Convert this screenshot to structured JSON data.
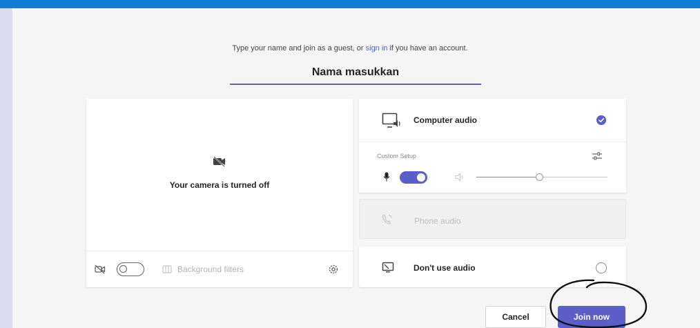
{
  "prompt": {
    "before": "Type your name and join as a guest, or ",
    "link": "sign in",
    "after": " if you have an account."
  },
  "name_input": {
    "value": "Nama masukkan"
  },
  "video": {
    "camera_status": "Your camera is turned off",
    "camera_toggle_on": false,
    "background_filters_label": "Background filters",
    "icons": [
      "camera-off-icon",
      "video-camera-icon",
      "background-filters-icon",
      "settings-gear-icon"
    ]
  },
  "audio": {
    "computer_audio_label": "Computer audio",
    "computer_audio_selected": true,
    "custom_setup_label": "Custom Setup",
    "mic_on": true,
    "volume_level": 0.48,
    "phone_audio_label": "Phone audio",
    "phone_audio_disabled": true,
    "no_audio_label": "Don't use audio",
    "no_audio_selected": false
  },
  "buttons": {
    "cancel": "Cancel",
    "join": "Join now"
  },
  "colors": {
    "top_bar": "#0f7dd4",
    "accent": "#5b5fc7",
    "background": "#f5f5f5",
    "sidebar_strip": "#dadbf0"
  }
}
